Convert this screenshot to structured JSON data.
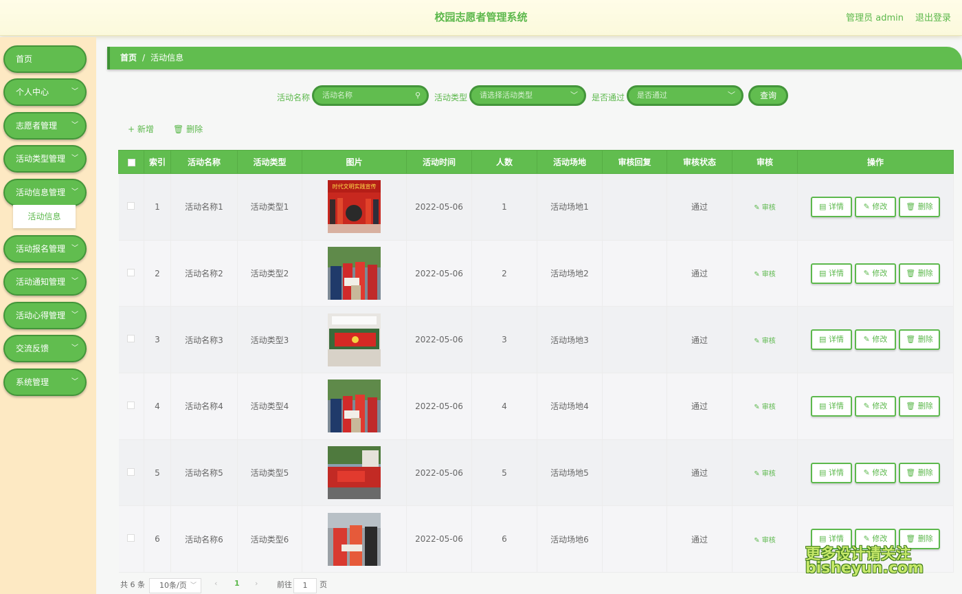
{
  "header": {
    "title": "校园志愿者管理系统",
    "user": "管理员 admin",
    "logout": "退出登录"
  },
  "sidebar": {
    "items": [
      {
        "label": "首页",
        "has_children": false
      },
      {
        "label": "个人中心",
        "has_children": true
      },
      {
        "label": "志愿者管理",
        "has_children": true
      },
      {
        "label": "活动类型管理",
        "has_children": true
      },
      {
        "label": "活动信息管理",
        "has_children": true
      },
      {
        "label": "活动报名管理",
        "has_children": true
      },
      {
        "label": "活动通知管理",
        "has_children": true
      },
      {
        "label": "活动心得管理",
        "has_children": true
      },
      {
        "label": "交流反馈",
        "has_children": true
      },
      {
        "label": "系统管理",
        "has_children": true
      }
    ],
    "submenu": "活动信息"
  },
  "breadcrumb": {
    "home": "首页",
    "separator": "/",
    "current": "活动信息"
  },
  "search": {
    "name_label": "活动名称",
    "name_placeholder": "活动名称",
    "type_label": "活动类型",
    "type_placeholder": "请选择活动类型",
    "pass_label": "是否通过",
    "pass_placeholder": "是否通过",
    "query_btn": "查询"
  },
  "toolbar": {
    "add": "+ 新增",
    "delete": "删除"
  },
  "table": {
    "headers": [
      "",
      "索引",
      "活动名称",
      "活动类型",
      "图片",
      "活动时间",
      "人数",
      "活动场地",
      "审核回复",
      "审核状态",
      "审核",
      "操作"
    ],
    "rows": [
      {
        "index": "1",
        "name": "活动名称1",
        "type": "活动类型1",
        "time": "2022-05-06",
        "count": "1",
        "place": "活动场地1",
        "reply": "",
        "status": "通过",
        "image_text": "时代文明实践宣传"
      },
      {
        "index": "2",
        "name": "活动名称2",
        "type": "活动类型2",
        "time": "2022-05-06",
        "count": "2",
        "place": "活动场地2",
        "reply": "",
        "status": "通过",
        "image_text": ""
      },
      {
        "index": "3",
        "name": "活动名称3",
        "type": "活动类型3",
        "time": "2022-05-06",
        "count": "3",
        "place": "活动场地3",
        "reply": "",
        "status": "通过",
        "image_text": ""
      },
      {
        "index": "4",
        "name": "活动名称4",
        "type": "活动类型4",
        "time": "2022-05-06",
        "count": "4",
        "place": "活动场地4",
        "reply": "",
        "status": "通过",
        "image_text": ""
      },
      {
        "index": "5",
        "name": "活动名称5",
        "type": "活动类型5",
        "time": "2022-05-06",
        "count": "5",
        "place": "活动场地5",
        "reply": "",
        "status": "通过",
        "image_text": ""
      },
      {
        "index": "6",
        "name": "活动名称6",
        "type": "活动类型6",
        "time": "2022-05-06",
        "count": "6",
        "place": "活动场地6",
        "reply": "",
        "status": "通过",
        "image_text": ""
      }
    ],
    "review_label": "审核",
    "actions": {
      "detail": "详情",
      "edit": "修改",
      "delete": "删除"
    }
  },
  "pagination": {
    "total": "共 6 条",
    "page_size": "10条/页",
    "current_page": "1",
    "goto_prefix": "前往",
    "goto_value": "1",
    "goto_suffix": "页"
  },
  "watermark": {
    "line1": "更多设计请关注",
    "line2": "bisheyun.com"
  },
  "colors": {
    "accent": "#61bd4f",
    "accent_dark": "#43953a",
    "sidebar_bg": "#fde9c3"
  }
}
